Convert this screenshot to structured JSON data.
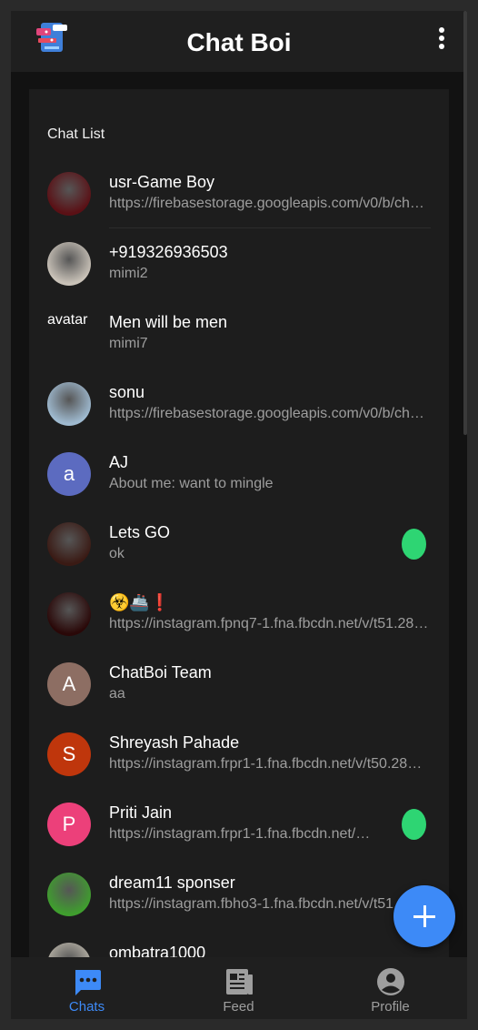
{
  "app": {
    "title": "Chat Boi",
    "icons": {
      "logo": "chatbot-logo-icon",
      "menu": "more-vert-icon"
    }
  },
  "chat_list": {
    "title": "Chat List",
    "chats": [
      {
        "name": "usr-Game Boy",
        "preview": "https://firebasestorage.googleapis.com/v0/b/chatboi.appspot.com/o/images",
        "avatar": "photo",
        "avatar_color": "#5a1015",
        "unread": false
      },
      {
        "name": "+919326936503",
        "preview": "mimi2",
        "avatar": "photo",
        "avatar_color": "#c9c2b8",
        "unread": false
      },
      {
        "name": "Men will be men",
        "preview": "mimi7",
        "avatar": "broken-image",
        "avatar_text": "avatar",
        "unread": false
      },
      {
        "name": "sonu",
        "preview": "https://firebasestorage.googleapis.com/v0/b/chatboi.appspot.com/o/images",
        "avatar": "photo",
        "avatar_color": "#9fbad0",
        "unread": false
      },
      {
        "name": "AJ",
        "preview": "About me: want to mingle",
        "avatar": "letter",
        "letter": "a",
        "avatar_color": "#5c6bc0",
        "unread": false
      },
      {
        "name": "Lets GO",
        "preview": "ok",
        "avatar": "photo",
        "avatar_color": "#3a1a14",
        "unread": true
      },
      {
        "name": "☣️🚢❗",
        "preview": "https://instagram.fpnq7-1.fna.fbcdn.net/v/t51.2885-19/s150x150",
        "avatar": "photo",
        "avatar_color": "#2a0808",
        "unread": false
      },
      {
        "name": "ChatBoi Team",
        "preview": "aa",
        "avatar": "letter",
        "letter": "A",
        "avatar_color": "#8d6e63",
        "unread": false
      },
      {
        "name": "Shreyash Pahade",
        "preview": "https://instagram.frpr1-1.fna.fbcdn.net/v/t50.2886-16/",
        "avatar": "letter",
        "letter": "S",
        "avatar_color": "#bf360c",
        "unread": false
      },
      {
        "name": "Priti Jain",
        "preview": "https://instagram.frpr1-1.fna.fbcdn.net/v/t51.2885-19/",
        "avatar": "letter",
        "letter": "P",
        "avatar_color": "#ec407a",
        "unread": true
      },
      {
        "name": "dream11 sponser",
        "preview": "https://instagram.fbho3-1.fna.fbcdn.net/v/t51.2885-19/",
        "avatar": "photo",
        "avatar_color": "#3f9e2e",
        "unread": false
      },
      {
        "name": "ombatra1000",
        "preview": "",
        "avatar": "photo",
        "avatar_color": "#b9b4a8",
        "unread": false
      }
    ],
    "unread_color": "#2ed573"
  },
  "fab": {
    "icon": "plus-icon",
    "color": "#3d8af7"
  },
  "bottom_nav": {
    "items": [
      {
        "label": "Chats",
        "icon": "chat-icon",
        "active": true
      },
      {
        "label": "Feed",
        "icon": "newspaper-icon",
        "active": false
      },
      {
        "label": "Profile",
        "icon": "account-circle-icon",
        "active": false
      }
    ],
    "active_color": "#3d8af7",
    "inactive_color": "#9e9e9e"
  }
}
